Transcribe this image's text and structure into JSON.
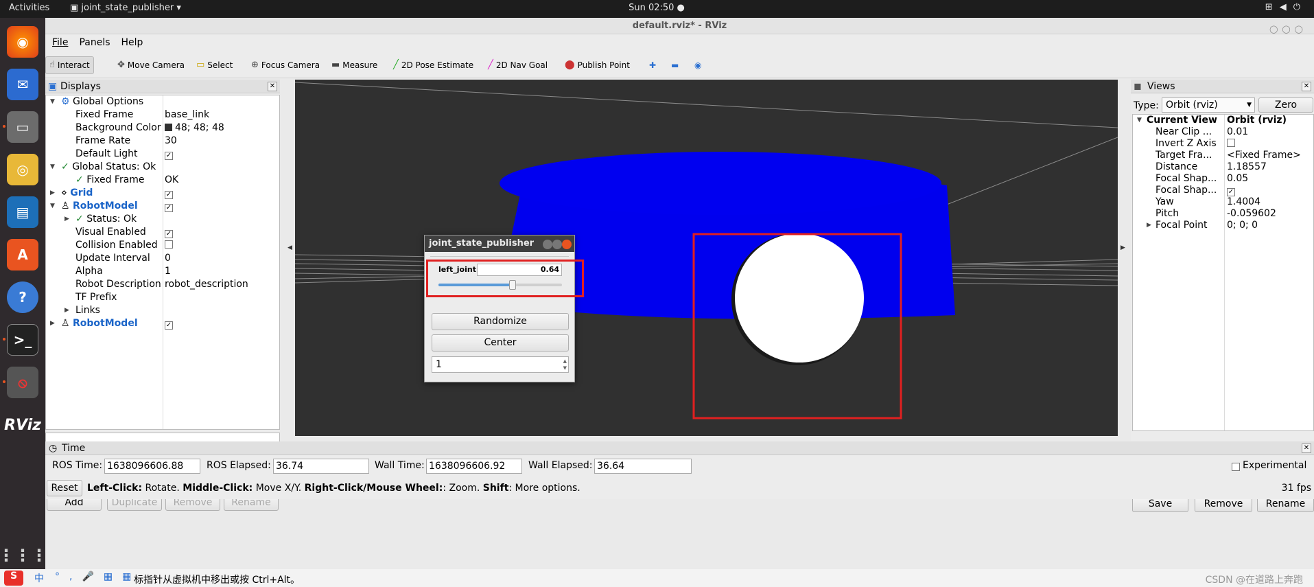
{
  "topbar": {
    "activities": "Activities",
    "app_name": "joint_state_publisher",
    "clock": "Sun 02:50"
  },
  "window": {
    "title": "default.rviz* - RViz"
  },
  "menu": [
    "File",
    "Panels",
    "Help"
  ],
  "toolbar": {
    "interact": "Interact",
    "move_camera": "Move Camera",
    "select": "Select",
    "focus_camera": "Focus Camera",
    "measure": "Measure",
    "pose_estimate": "2D Pose Estimate",
    "nav_goal": "2D Nav Goal",
    "publish_point": "Publish Point"
  },
  "displays": {
    "title": "Displays",
    "rows": [
      {
        "k": "Global Options",
        "v": ""
      },
      {
        "k": "Fixed Frame",
        "v": "base_link"
      },
      {
        "k": "Background Color",
        "v": "48; 48; 48"
      },
      {
        "k": "Frame Rate",
        "v": "30"
      },
      {
        "k": "Default Light",
        "v": ""
      },
      {
        "k": "Global Status: Ok",
        "v": ""
      },
      {
        "k": "Fixed Frame",
        "v": "OK"
      },
      {
        "k": "Grid",
        "v": ""
      },
      {
        "k": "RobotModel",
        "v": ""
      },
      {
        "k": "Status: Ok",
        "v": ""
      },
      {
        "k": "Visual Enabled",
        "v": ""
      },
      {
        "k": "Collision Enabled",
        "v": ""
      },
      {
        "k": "Update Interval",
        "v": "0"
      },
      {
        "k": "Alpha",
        "v": "1"
      },
      {
        "k": "Robot Description",
        "v": "robot_description"
      },
      {
        "k": "TF Prefix",
        "v": ""
      },
      {
        "k": "Links",
        "v": ""
      },
      {
        "k": "RobotModel",
        "v": ""
      }
    ],
    "buttons": {
      "add": "Add",
      "duplicate": "Duplicate",
      "remove": "Remove",
      "rename": "Rename"
    }
  },
  "jsp": {
    "title": "joint_state_publisher",
    "joint_name": "left_joint",
    "joint_value": "0.64",
    "slider_fraction": 0.6,
    "randomize": "Randomize",
    "center": "Center",
    "spin_value": "1"
  },
  "views": {
    "title": "Views",
    "type_label": "Type:",
    "type_value": "Orbit (rviz)",
    "zero": "Zero",
    "current_view": "Current View",
    "current_view_value": "Orbit (rviz)",
    "props": [
      {
        "k": "Near Clip ...",
        "v": "0.01"
      },
      {
        "k": "Invert Z Axis",
        "v": ""
      },
      {
        "k": "Target Fra...",
        "v": "<Fixed Frame>"
      },
      {
        "k": "Distance",
        "v": "1.18557"
      },
      {
        "k": "Focal Shap...",
        "v": "0.05"
      },
      {
        "k": "Focal Shap...",
        "v": ""
      },
      {
        "k": "Yaw",
        "v": "1.4004"
      },
      {
        "k": "Pitch",
        "v": "-0.059602"
      },
      {
        "k": "Focal Point",
        "v": "0; 0; 0"
      }
    ],
    "save": "Save",
    "remove": "Remove",
    "rename": "Rename"
  },
  "time": {
    "title": "Time",
    "ros_time_label": "ROS Time:",
    "ros_time": "1638096606.88",
    "ros_elapsed_label": "ROS Elapsed:",
    "ros_elapsed": "36.74",
    "wall_time_label": "Wall Time:",
    "wall_time": "1638096606.92",
    "wall_elapsed_label": "Wall Elapsed:",
    "wall_elapsed": "36.64",
    "experimental": "Experimental"
  },
  "status": {
    "reset": "Reset",
    "help_b1": "Left-Click:",
    "help_t1": " Rotate. ",
    "help_b2": "Middle-Click:",
    "help_t2": " Move X/Y. ",
    "help_b3": "Right-Click/Mouse Wheel:",
    "help_t3": ": Zoom. ",
    "help_b4": "Shift",
    "help_t4": ": More options.",
    "fps": "31 fps"
  },
  "ime": {
    "lang": "中",
    "hint": "标指针从虚拟机中移出或按 Ctrl+Alt。",
    "watermark": "CSDN @在道路上奔跑"
  },
  "colors": {
    "accent_red": "#e02020",
    "cylinder_blue": "#0000ee",
    "bg": "#303030"
  }
}
